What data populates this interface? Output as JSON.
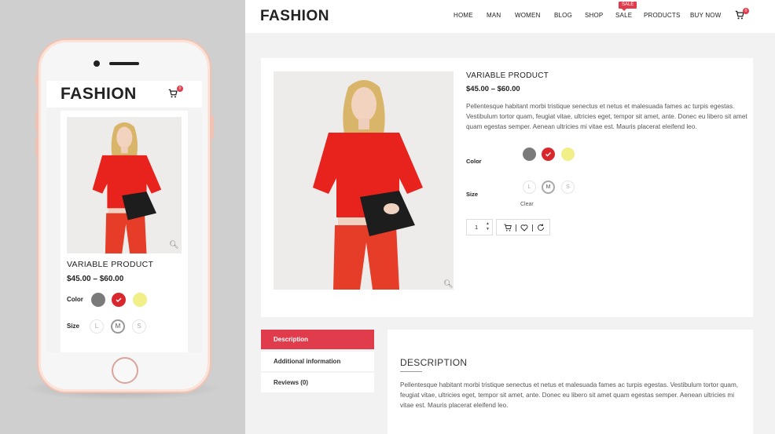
{
  "mobile": {
    "logo": "FASHION",
    "cart_count": "0",
    "product_title": "VARIABLE PRODUCT",
    "price": "$45.00 – $60.00",
    "color_label": "Color",
    "size_label": "Size",
    "sizes": [
      "L",
      "M",
      "S"
    ]
  },
  "header": {
    "logo": "FASHION",
    "nav": [
      "HOME",
      "MAN",
      "WOMEN",
      "BLOG",
      "SHOP",
      "SALE",
      "PRODUCTS",
      "BUY NOW"
    ],
    "sale_badge": "SALE",
    "cart_count": "0"
  },
  "product": {
    "title": "VARIABLE PRODUCT",
    "price": "$45.00 – $60.00",
    "description": "Pellentesque habitant morbi tristique senectus et netus et malesuada fames ac turpis egestas. Vestibulum tortor quam, feugiat vitae, ultricies eget, tempor sit amet, ante. Donec eu libero sit amet quam egestas semper. Aenean ultricies mi vitae est. Mauris placerat eleifend leo.",
    "color_label": "Color",
    "colors": [
      "#7a7a7a",
      "#d8282e",
      "#f0ef88"
    ],
    "size_label": "Size",
    "sizes": [
      "L",
      "M",
      "S"
    ],
    "selected_size": "M",
    "clear_label": "Clear",
    "quantity": "1"
  },
  "tabs": [
    "Description",
    "Additional information",
    "Reviews (0)"
  ],
  "description_section": {
    "heading": "DESCRIPTION",
    "text": "Pellentesque habitant morbi tristique senectus et netus et malesuada fames ac turpis egestas. Vestibulum tortor quam, feugiat vitae, ultricies eget, tempor sit amet, ante. Donec eu libero sit amet quam egestas semper. Aenean ultricies mi vitae est. Mauris placerat eleifend leo."
  },
  "colors": {
    "accent": "#e13c4c",
    "background": "#f2f2f2"
  }
}
